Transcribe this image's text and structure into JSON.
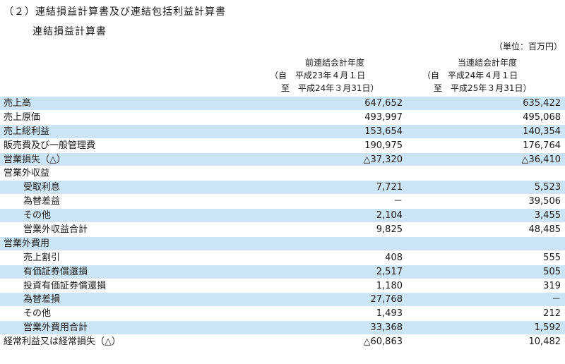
{
  "heading": "（２）連結損益計算書及び連結包括利益計算書",
  "subheading": "連結損益計算書",
  "unit": "（単位：百万円）",
  "columns": [
    {
      "title": "前連結会計年度",
      "from": "（自　平成23年４月１日",
      "to": "至　平成24年３月31日）"
    },
    {
      "title": "当連結会計年度",
      "from": "（自　平成24年４月１日",
      "to": "至　平成25年３月31日）"
    }
  ],
  "rows": [
    {
      "label": "売上高",
      "prev": "647,652",
      "curr": "635,422"
    },
    {
      "label": "売上原価",
      "prev": "493,997",
      "curr": "495,068"
    },
    {
      "label": "売上総利益",
      "prev": "153,654",
      "curr": "140,354"
    },
    {
      "label": "販売費及び一般管理費",
      "prev": "190,975",
      "curr": "176,764"
    },
    {
      "label": "営業損失（△）",
      "prev": "△37,320",
      "curr": "△36,410"
    },
    {
      "label": "営業外収益",
      "prev": "",
      "curr": ""
    },
    {
      "label": "受取利息",
      "prev": "7,721",
      "curr": "5,523"
    },
    {
      "label": "為替差益",
      "prev": "－",
      "curr": "39,506"
    },
    {
      "label": "その他",
      "prev": "2,104",
      "curr": "3,455"
    },
    {
      "label": "営業外収益合計",
      "prev": "9,825",
      "curr": "48,485"
    },
    {
      "label": "営業外費用",
      "prev": "",
      "curr": ""
    },
    {
      "label": "売上割引",
      "prev": "408",
      "curr": "555"
    },
    {
      "label": "有価証券償還損",
      "prev": "2,517",
      "curr": "505"
    },
    {
      "label": "投資有価証券償還損",
      "prev": "1,180",
      "curr": "319"
    },
    {
      "label": "為替差損",
      "prev": "27,768",
      "curr": "－"
    },
    {
      "label": "その他",
      "prev": "1,493",
      "curr": "212"
    },
    {
      "label": "営業外費用合計",
      "prev": "33,368",
      "curr": "1,592"
    },
    {
      "label": "経常利益又は経常損失（△）",
      "prev": "△60,863",
      "curr": "10,482"
    }
  ]
}
